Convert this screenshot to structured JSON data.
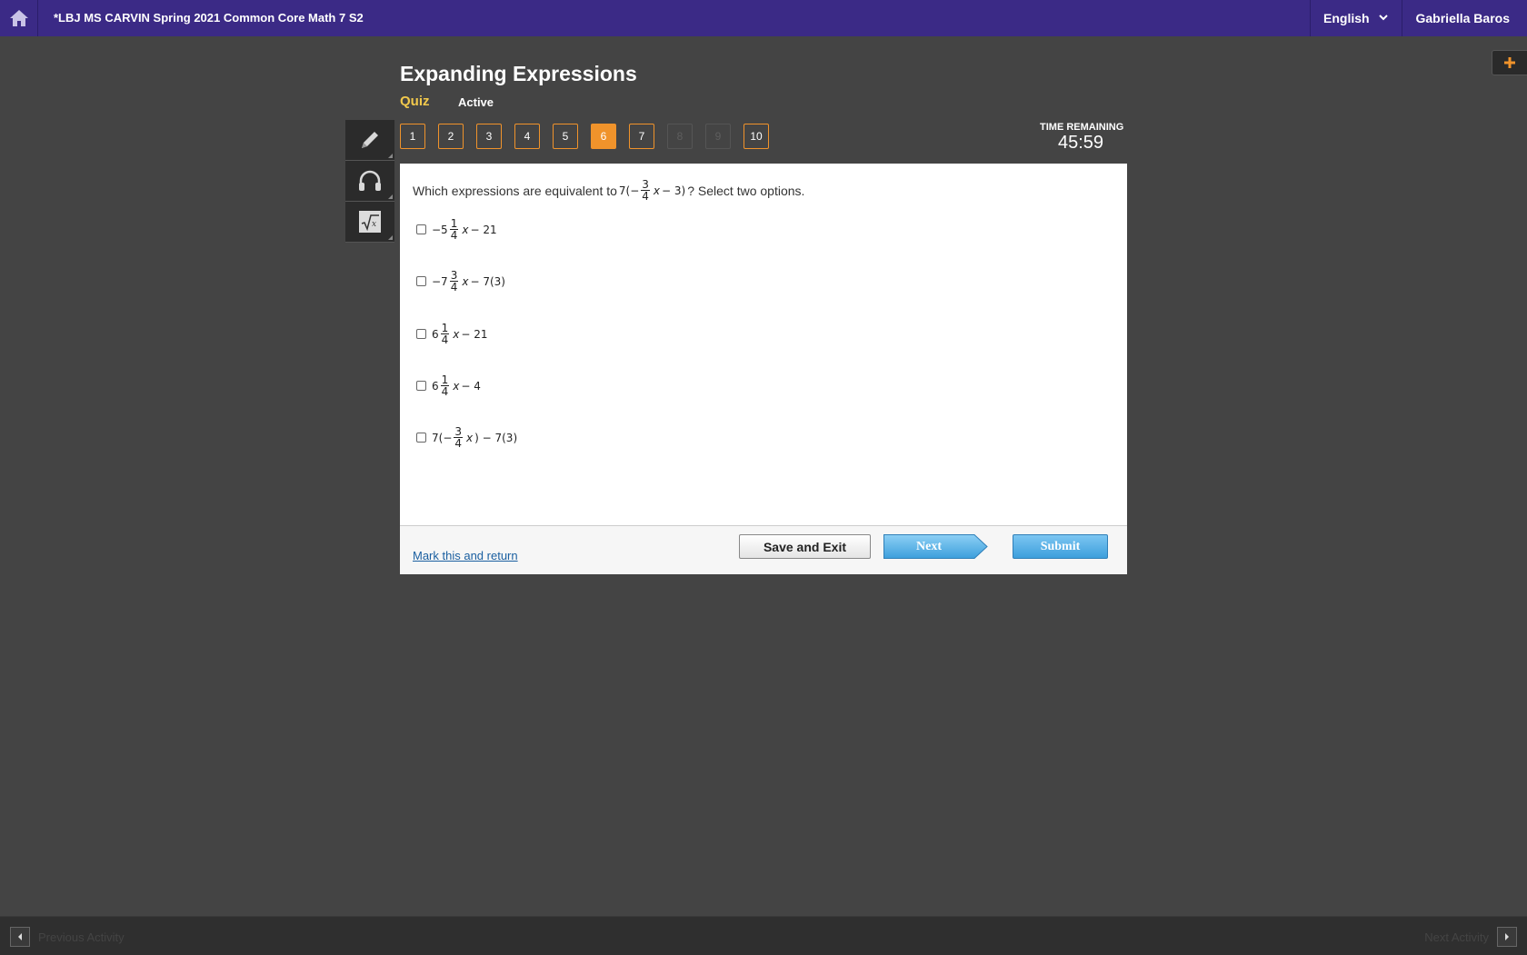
{
  "topbar": {
    "course_title": "*LBJ MS CARVIN Spring 2021 Common Core Math 7 S2",
    "language": "English",
    "user_name": "Gabriella Baros"
  },
  "activity": {
    "title": "Expanding Expressions",
    "type": "Quiz",
    "status": "Active"
  },
  "question_nav": [
    {
      "label": "1",
      "state": "normal"
    },
    {
      "label": "2",
      "state": "normal"
    },
    {
      "label": "3",
      "state": "normal"
    },
    {
      "label": "4",
      "state": "normal"
    },
    {
      "label": "5",
      "state": "normal"
    },
    {
      "label": "6",
      "state": "current"
    },
    {
      "label": "7",
      "state": "normal"
    },
    {
      "label": "8",
      "state": "disabled"
    },
    {
      "label": "9",
      "state": "disabled"
    },
    {
      "label": "10",
      "state": "normal"
    }
  ],
  "timer": {
    "label": "TIME REMAINING",
    "value": "45:59"
  },
  "question": {
    "prompt_before": "Which expressions are equivalent to ",
    "prompt_math": {
      "pre": "7(−",
      "num": "3",
      "den": "4",
      "var": "x",
      "post": "− 3)"
    },
    "prompt_after": "? Select two options.",
    "options": [
      {
        "pre": "−5",
        "num": "1",
        "den": "4",
        "var": "x",
        "post": "− 21"
      },
      {
        "pre": "−7",
        "num": "3",
        "den": "4",
        "var": "x",
        "post": "− 7(3)"
      },
      {
        "pre": "6",
        "num": "1",
        "den": "4",
        "var": "x",
        "post": "− 21"
      },
      {
        "pre": "6",
        "num": "1",
        "den": "4",
        "var": "x",
        "post": "− 4"
      },
      {
        "pre": "7(−",
        "num": "3",
        "den": "4",
        "var": "x",
        "post": ") − 7(3)"
      }
    ]
  },
  "footer": {
    "mark_link": "Mark this and return",
    "save_label": "Save and Exit",
    "next_label": "Next",
    "submit_label": "Submit"
  },
  "bottombar": {
    "prev_label": "Previous Activity",
    "next_label": "Next Activity"
  },
  "colors": {
    "topbar": "#3b2a86",
    "accent_orange": "#f0932b",
    "button_blue": "#4aa8e0"
  }
}
